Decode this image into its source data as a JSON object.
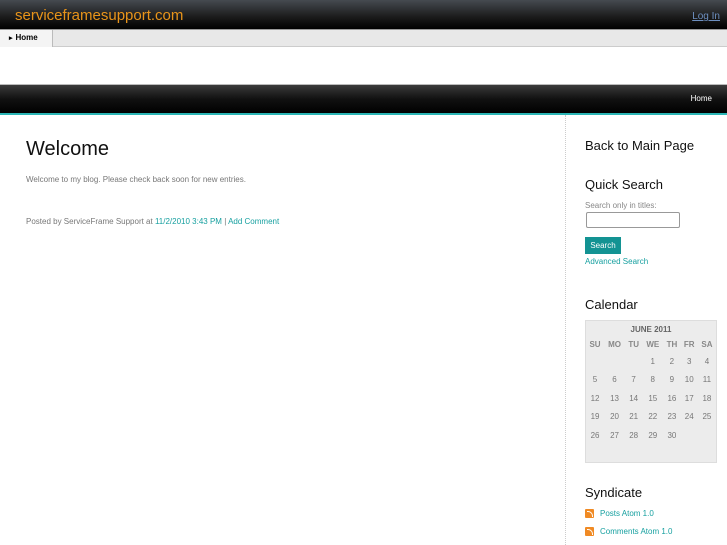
{
  "header": {
    "site_title": "serviceframesupport.com",
    "login": "Log In"
  },
  "nav": {
    "home": "Home"
  },
  "darkbar": {
    "home": "Home"
  },
  "post": {
    "title": "Welcome",
    "body": "Welcome to my blog. Please check back soon for new entries.",
    "posted_prefix": "Posted by ServiceFrame Support at ",
    "date": "11/2/2010 3:43 PM",
    "sep": " | ",
    "add_comment": "Add Comment"
  },
  "sidebar": {
    "back": "Back to Main Page",
    "search": {
      "title": "Quick Search",
      "label": "Search only in titles:",
      "value": "",
      "button": "Search",
      "advanced": "Advanced Search"
    },
    "calendar": {
      "title": "Calendar",
      "month": "JUNE 2011",
      "days": [
        "SU",
        "MO",
        "TU",
        "WE",
        "TH",
        "FR",
        "SA"
      ],
      "weeks": [
        [
          "",
          "",
          "",
          "1",
          "2",
          "3",
          "4"
        ],
        [
          "5",
          "6",
          "7",
          "8",
          "9",
          "10",
          "11"
        ],
        [
          "12",
          "13",
          "14",
          "15",
          "16",
          "17",
          "18"
        ],
        [
          "19",
          "20",
          "21",
          "22",
          "23",
          "24",
          "25"
        ],
        [
          "26",
          "27",
          "28",
          "29",
          "30",
          "",
          ""
        ]
      ]
    },
    "syndicate": {
      "title": "Syndicate",
      "links": [
        "Posts Atom 1.0",
        "Comments Atom 1.0"
      ]
    }
  },
  "colors": {
    "title": "#e8941a",
    "accent": "#17a0a0",
    "button": "#139393"
  }
}
